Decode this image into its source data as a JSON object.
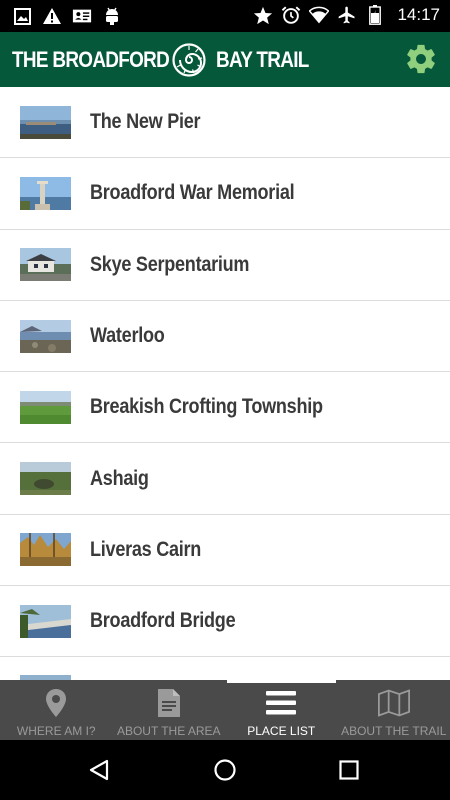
{
  "status_bar": {
    "time": "14:17",
    "icons_left": [
      "image-icon",
      "warning-icon",
      "contact-card-icon",
      "android-icon"
    ],
    "icons_right": [
      "star-icon",
      "alarm-icon",
      "wifi-icon",
      "airplane-icon",
      "battery-icon"
    ]
  },
  "app_bar": {
    "title_left": "THE BROADFORD",
    "title_right": "BAY TRAIL",
    "logo_icon": "ammonite-logo-icon",
    "settings_icon": "gear-icon",
    "background_color": "#05593a"
  },
  "places": [
    {
      "name": "The New Pier"
    },
    {
      "name": "Broadford War Memorial"
    },
    {
      "name": "Skye Serpentarium"
    },
    {
      "name": "Waterloo"
    },
    {
      "name": "Breakish Crofting Township"
    },
    {
      "name": "Ashaig"
    },
    {
      "name": "Liveras Cairn"
    },
    {
      "name": "Broadford Bridge"
    }
  ],
  "tabs": [
    {
      "label": "WHERE AM I?",
      "icon": "map-pin-icon",
      "active": false
    },
    {
      "label": "ABOUT THE AREA",
      "icon": "document-icon",
      "active": false
    },
    {
      "label": "PLACE LIST",
      "icon": "list-icon",
      "active": true
    },
    {
      "label": "ABOUT THE TRAIL",
      "icon": "map-icon",
      "active": false
    }
  ],
  "nav": {
    "back": "back-icon",
    "home": "home-icon",
    "recents": "recents-icon"
  }
}
